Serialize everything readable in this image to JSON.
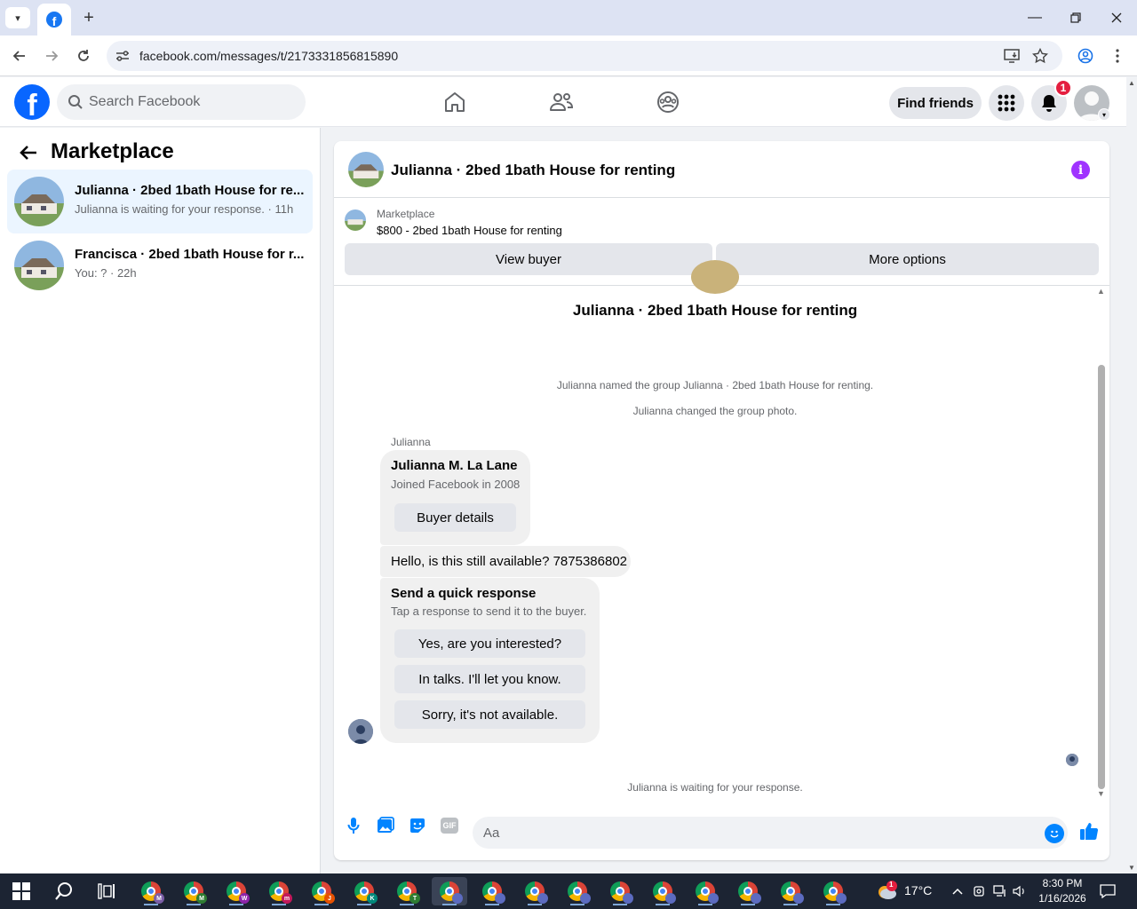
{
  "browser": {
    "url": "facebook.com/messages/t/2173331856815890",
    "tab_favicon_letter": "f",
    "new_tab_symbol": "+"
  },
  "header": {
    "search_placeholder": "Search Facebook",
    "find_friends_label": "Find friends",
    "notification_count": "1",
    "logo_letter": "f"
  },
  "sidebar": {
    "title": "Marketplace",
    "conversations": [
      {
        "title": "Julianna · 2bed 1bath House for re...",
        "subtitle": "Julianna is waiting for your response. · 11h",
        "active": true
      },
      {
        "title": "Francisca · 2bed 1bath House for r...",
        "subtitle": "You: ? · 22h",
        "active": false
      }
    ]
  },
  "chat": {
    "title": "Julianna · 2bed 1bath House for renting",
    "marketplace_label": "Marketplace",
    "product": "$800 - 2bed 1bath House for renting",
    "view_buyer_label": "View buyer",
    "more_options_label": "More options",
    "conversation_title": "Julianna · 2bed 1bath House for renting",
    "system_messages": [
      "Julianna named the group Julianna · 2bed 1bath House for renting.",
      "Julianna changed the group photo."
    ],
    "sender_name": "Julianna",
    "buyer_card": {
      "name": "Julianna M. La Lane",
      "joined": "Joined Facebook in 2008",
      "button_label": "Buyer details"
    },
    "message": "Hello, is this still available? 7875386802",
    "quick_response": {
      "title": "Send a quick response",
      "subtitle": "Tap a response to send it to the buyer.",
      "options": [
        "Yes, are you interested?",
        "In talks. I'll let you know.",
        "Sorry, it's not available."
      ]
    },
    "waiting_text": "Julianna is waiting for your response.",
    "composer_placeholder": "Aa",
    "gif_label": "GIF"
  },
  "taskbar": {
    "apps": [
      {
        "badge": "M",
        "badge_color": "#7b5ea7"
      },
      {
        "badge": "M",
        "badge_color": "#2e7d32"
      },
      {
        "badge": "W",
        "badge_color": "#8e24aa"
      },
      {
        "badge": "m",
        "badge_color": "#c2185b"
      },
      {
        "badge": "J",
        "badge_color": "#e65100"
      },
      {
        "badge": "K",
        "badge_color": "#00897b"
      },
      {
        "badge": "T",
        "badge_color": "#2e7d32"
      },
      {
        "badge": "",
        "badge_color": "#5c6bc0"
      },
      {
        "badge": "",
        "badge_color": "#5c6bc0"
      },
      {
        "badge": "",
        "badge_color": "#5c6bc0"
      },
      {
        "badge": "",
        "badge_color": "#5c6bc0"
      },
      {
        "badge": "",
        "badge_color": "#5c6bc0"
      },
      {
        "badge": "",
        "badge_color": "#5c6bc0"
      },
      {
        "badge": "",
        "badge_color": "#5c6bc0"
      },
      {
        "badge": "",
        "badge_color": "#5c6bc0"
      },
      {
        "badge": "",
        "badge_color": "#5c6bc0"
      },
      {
        "badge": "",
        "badge_color": "#5c6bc0"
      }
    ],
    "weather_badge": "1",
    "temperature": "17°C",
    "time": "8:30 PM",
    "date": "1/16/2026"
  },
  "colors": {
    "brand_blue": "#0866ff",
    "accent_purple": "#a033ff",
    "active_conv": "#ebf5ff",
    "notif_red": "#e41e3f"
  }
}
